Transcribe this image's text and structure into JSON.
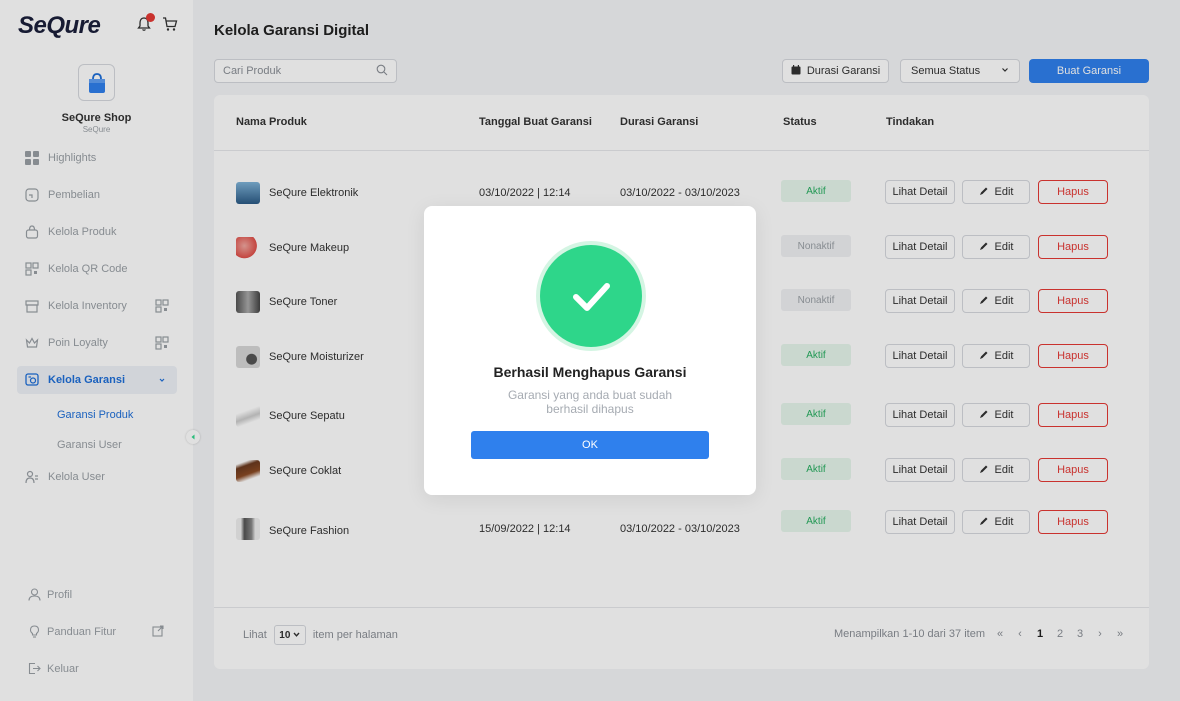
{
  "app": {
    "logo": "SeQure"
  },
  "sidebar": {
    "shop_name": "SeQure Shop",
    "shop_sub": "SeQure",
    "items": [
      {
        "label": "Highlights",
        "icon": "grid-icon"
      },
      {
        "label": "Pembelian",
        "icon": "receipt-icon"
      },
      {
        "label": "Kelola Produk",
        "icon": "bag-icon"
      },
      {
        "label": "Kelola QR Code",
        "icon": "qr-icon"
      },
      {
        "label": "Kelola Inventory",
        "icon": "inventory-icon"
      },
      {
        "label": "Poin Loyalty",
        "icon": "crown-icon"
      },
      {
        "label": "Kelola Garansi",
        "icon": "warranty-icon"
      }
    ],
    "sub_items": [
      {
        "label": "Garansi Produk"
      },
      {
        "label": "Garansi User"
      }
    ],
    "user_item": {
      "label": "Kelola User"
    },
    "bottom": [
      {
        "label": "Profil"
      },
      {
        "label": "Panduan Fitur"
      },
      {
        "label": "Keluar"
      }
    ]
  },
  "header": {
    "title": "Kelola Garansi Digital",
    "search_placeholder": "Cari Produk",
    "durasi_label": "Durasi Garansi",
    "status_select": "Semua Status",
    "buat_label": "Buat Garansi"
  },
  "table": {
    "columns": [
      "Nama Produk",
      "Tanggal Buat Garansi",
      "Durasi Garansi",
      "Status",
      "Tindakan"
    ],
    "rows": [
      {
        "name": "SeQure Elektronik",
        "date": "03/10/2022 | 12:14",
        "duration": "03/10/2022 - 03/10/2023",
        "status": "Aktif"
      },
      {
        "name": "SeQure Makeup",
        "date": "",
        "duration": "",
        "status": "Nonaktif"
      },
      {
        "name": "SeQure Toner",
        "date": "",
        "duration": "",
        "status": "Nonaktif"
      },
      {
        "name": "SeQure Moisturizer",
        "date": "",
        "duration": "",
        "status": "Aktif"
      },
      {
        "name": "SeQure Sepatu",
        "date": "",
        "duration": "",
        "status": "Aktif"
      },
      {
        "name": "SeQure Coklat",
        "date": "",
        "duration": "",
        "status": "Aktif"
      },
      {
        "name": "SeQure Fashion",
        "date": "15/09/2022 | 12:14",
        "duration": "03/10/2022 - 03/10/2023",
        "status": "Aktif"
      }
    ],
    "actions": {
      "detail": "Lihat Detail",
      "edit": "Edit",
      "delete": "Hapus"
    }
  },
  "footer": {
    "show_label": "Lihat",
    "per_page": "10",
    "per_page_suffix": "item per halaman",
    "summary": "Menampilkan 1-10 dari 37 item",
    "pages": [
      "1",
      "2",
      "3"
    ]
  },
  "modal": {
    "title": "Berhasil Menghapus Garansi",
    "message": "Garansi yang anda buat sudah berhasil dihapus",
    "ok_label": "OK"
  },
  "colors": {
    "primary": "#2f80ed",
    "success": "#2ed68a",
    "danger": "#e53935"
  }
}
